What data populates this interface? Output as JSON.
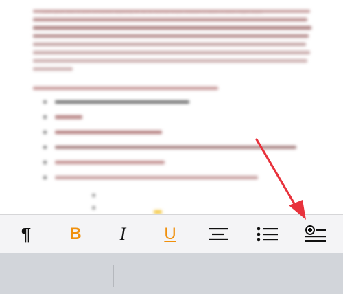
{
  "document": {
    "body_text": "Lorem ipsum dolor sit amet consectetur adipiscing elit sed do eiusmod tempor incididunt ut labore et dolore magna aliqua"
  },
  "toolbar": {
    "buttons": [
      {
        "name": "paragraph",
        "glyph": "¶"
      },
      {
        "name": "bold",
        "glyph": "B"
      },
      {
        "name": "italic",
        "glyph": "I"
      },
      {
        "name": "underline",
        "glyph": "U"
      },
      {
        "name": "align",
        "glyph": ""
      },
      {
        "name": "list",
        "glyph": ""
      },
      {
        "name": "insert",
        "glyph": ""
      }
    ]
  },
  "colors": {
    "accent": "#f0900c",
    "icon": "#111111",
    "arrow": "#e8323c",
    "toolbar_bg": "#f4f4f6",
    "keyboard_bg": "#d2d5da"
  },
  "icons": {
    "paragraph": "pilcrow-icon",
    "bold": "bold-icon",
    "italic": "italic-icon",
    "underline": "underline-icon",
    "align": "align-center-icon",
    "list": "bullet-list-icon",
    "insert": "insert-above-icon"
  }
}
